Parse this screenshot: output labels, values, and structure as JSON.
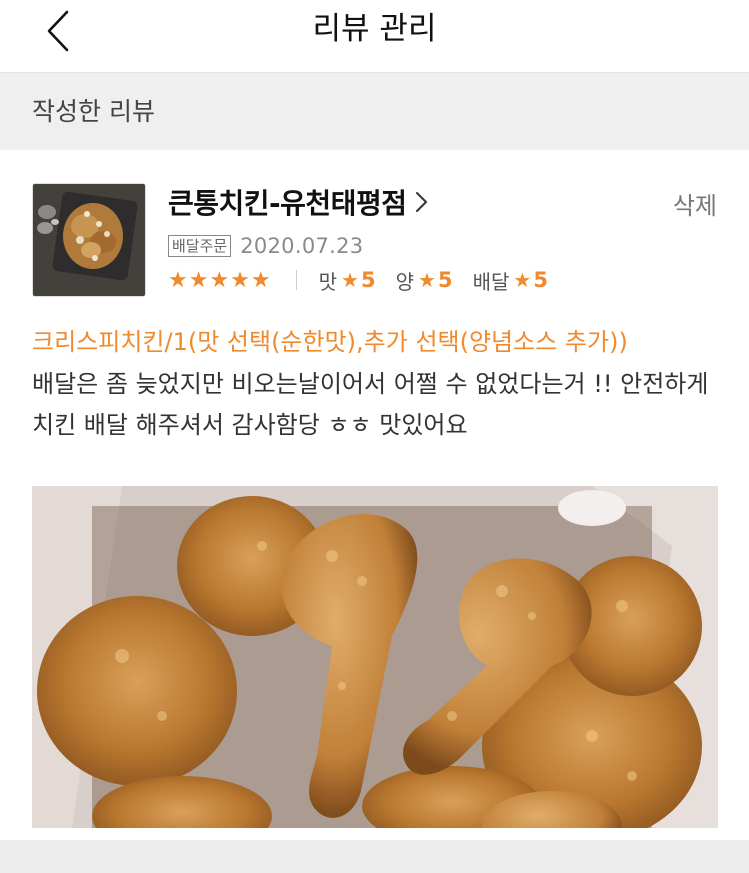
{
  "header": {
    "title": "리뷰 관리",
    "back_icon": "chevron-left-icon"
  },
  "section": {
    "label": "작성한 리뷰"
  },
  "review": {
    "store_name": "큰통치킨-유천태평점",
    "store_link_icon": "chevron-right-icon",
    "delete_label": "삭제",
    "order_type_badge": "배달주문",
    "date": "2020.07.23",
    "overall_stars": "★★★★★",
    "overall_rating": 5,
    "sub_ratings": [
      {
        "label": "맛",
        "star": "★",
        "score": "5"
      },
      {
        "label": "양",
        "star": "★",
        "score": "5"
      },
      {
        "label": "배달",
        "star": "★",
        "score": "5"
      }
    ],
    "menu": "크리스피치킨/1(맛 선택(순한맛),추가 선택(양념소스 추가))",
    "text": "배달은 좀 늦었지만 비오는날이어서 어쩔 수 없었다는거 !! 안전하게 치킨 배달 해주셔서 감사함당 ㅎㅎ 맛있어요"
  },
  "colors": {
    "accent": "#f08a2c",
    "section_bg": "#efefef",
    "text_primary": "#111111",
    "text_secondary": "#8a8a8a"
  }
}
